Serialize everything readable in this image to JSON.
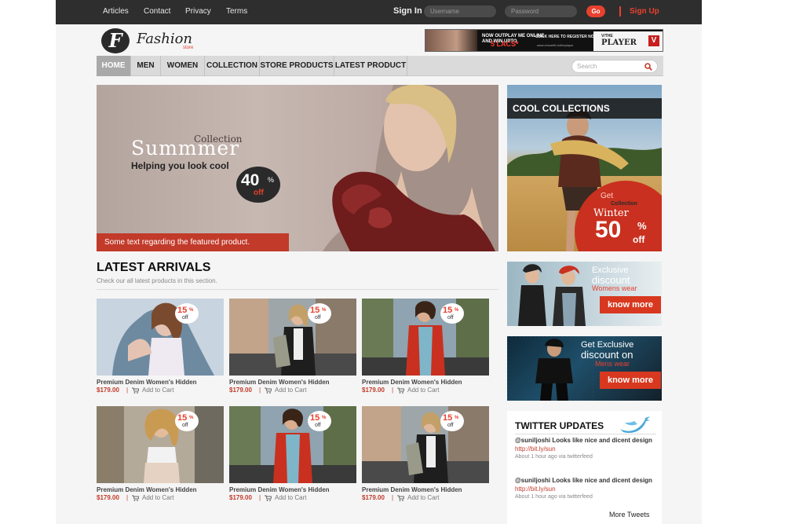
{
  "topbar": {
    "links": [
      "Articles",
      "Contact",
      "Privacy",
      "Terms"
    ],
    "signin_label": "Sign In",
    "username_placeholder": "Username",
    "password_placeholder": "Password",
    "go_label": "Go",
    "signup_label": "Sign Up"
  },
  "header": {
    "logo_letter": "F",
    "logo_name": "Fashion",
    "logo_sub": "store",
    "ad": {
      "line1a": "NOW OUTPLAY ME ONLINE",
      "line1b": "AND WIN UPTO",
      "highlight": "5 LACS*",
      "line2": "CLICK HERE TO REGISTER NOW",
      "url": "www.vhsnetfb.in/theplayer",
      "brand_top": "V/THE",
      "brand": "PLAYER",
      "brand_badge": "V"
    }
  },
  "nav": {
    "items": [
      "HOME",
      "MEN",
      "WOMEN",
      "COLLECTION",
      "STORE PRODUCTS",
      "LATEST PRODUCT"
    ],
    "active": "HOME",
    "search_placeholder": "Search"
  },
  "hero": {
    "collection": "Collection",
    "title": "Summmer",
    "tagline": "Helping you look cool",
    "discount_number": "40",
    "discount_pct": "%",
    "discount_off": "off",
    "caption": "Some text regarding the featured product."
  },
  "cool": {
    "header": "COOL COLLECTIONS",
    "get": "Get",
    "collection": "Collection",
    "season": "Winter",
    "discount_number": "50",
    "discount_pct": "%",
    "discount_off": "off"
  },
  "arrivals": {
    "title": "LATEST ARRIVALS",
    "subtitle": "Check our all latest products in this section.",
    "products": [
      {
        "title": "Premium Denim Women's Hidden",
        "price": "$179.00",
        "discount": "15",
        "off": "off",
        "cart": "Add to Cart"
      },
      {
        "title": "Premium Denim Women's Hidden",
        "price": "$179.00",
        "discount": "15",
        "off": "off",
        "cart": "Add to Cart"
      },
      {
        "title": "Premium Denim Women's Hidden",
        "price": "$179.00",
        "discount": "15",
        "off": "off",
        "cart": "Add to Cart"
      },
      {
        "title": "Premium Denim Women's Hidden",
        "price": "$179.00",
        "discount": "15",
        "off": "off",
        "cart": "Add to Cart"
      },
      {
        "title": "Premium Denim Women's Hidden",
        "price": "$179.00",
        "discount": "15",
        "off": "off",
        "cart": "Add to Cart"
      },
      {
        "title": "Premium Denim Women's Hidden",
        "price": "$179.00",
        "discount": "15",
        "off": "off",
        "cart": "Add to Cart"
      }
    ]
  },
  "promos": [
    {
      "line1": "Exclusive",
      "line2": "discount",
      "line3": "Womens wear",
      "button": "know more"
    },
    {
      "line1": "Get Exclusive",
      "line2": "discount on",
      "line3": "Mens wear",
      "button": "know more"
    }
  ],
  "twitter": {
    "title": "TWITTER UPDATES",
    "tweets": [
      {
        "text": "@suniljoshi Looks like nice and dicent design",
        "link": "http://bit.ly/sun",
        "meta": "About 1 hour ago via twitterfeed"
      },
      {
        "text": "@suniljoshi Looks like nice and dicent design",
        "link": "http://bit.ly/sun",
        "meta": "About 1 hour ago via twitterfeed"
      }
    ],
    "more": "More Tweets"
  },
  "colors": {
    "accent": "#e8412f",
    "topbar": "#2e2e2e",
    "nav": "#dadada",
    "caption": "#c23a2a"
  }
}
